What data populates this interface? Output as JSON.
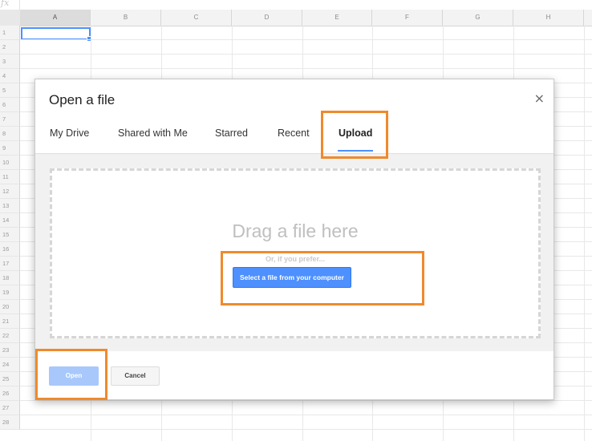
{
  "formula_bar": {
    "fx_label": "fx"
  },
  "sheet": {
    "columns": [
      "A",
      "B",
      "C",
      "D",
      "E",
      "F",
      "G",
      "H"
    ],
    "rows": [
      "1",
      "2",
      "3",
      "4",
      "5",
      "6",
      "7",
      "8",
      "9",
      "10",
      "11",
      "12",
      "13",
      "14",
      "15",
      "16",
      "17",
      "18",
      "19",
      "20",
      "21",
      "22",
      "23",
      "24",
      "25",
      "26",
      "27",
      "28"
    ]
  },
  "dialog": {
    "title": "Open a file",
    "close_glyph": "×",
    "tabs": [
      {
        "label": "My Drive"
      },
      {
        "label": "Shared with Me"
      },
      {
        "label": "Starred"
      },
      {
        "label": "Recent"
      },
      {
        "label": "Upload",
        "selected": true
      }
    ],
    "upload": {
      "drop_title": "Drag a file here",
      "drop_subtitle": "Or, if you prefer...",
      "select_button": "Select a file from your computer"
    },
    "footer": {
      "open_label": "Open",
      "cancel_label": "Cancel"
    }
  },
  "colors": {
    "accent_blue": "#4d90fe",
    "highlight_orange": "#ef8a2c",
    "open_disabled": "#a8c8fb"
  }
}
